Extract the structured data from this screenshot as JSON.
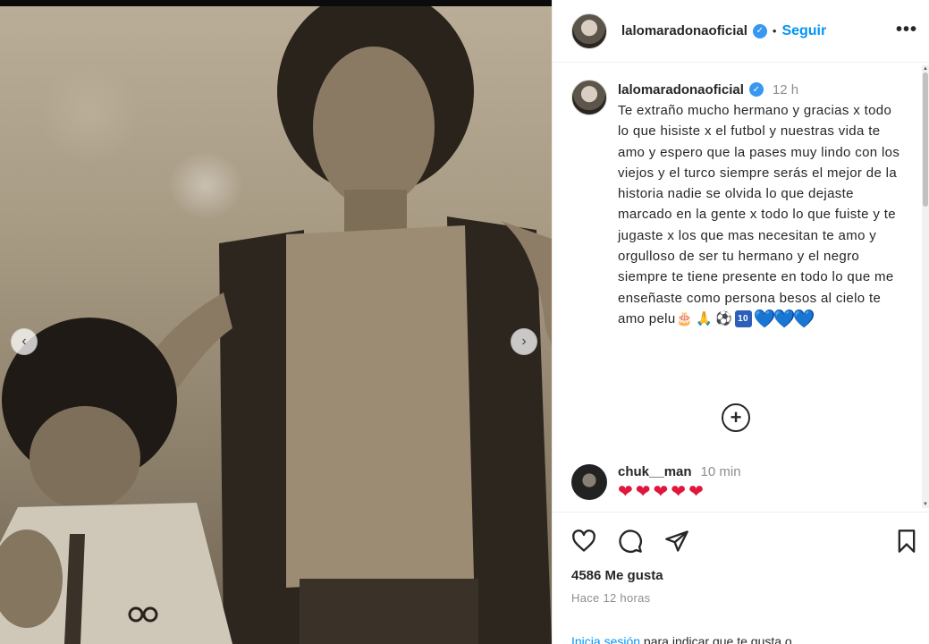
{
  "header": {
    "username": "lalomaradonaoficial",
    "dot": "•",
    "follow_label": "Seguir",
    "more_label": "•••"
  },
  "caption": {
    "username": "lalomaradonaoficial",
    "time_ago": "12 h",
    "text": "Te extraño mucho hermano y gracias x todo lo que hisiste x el futbol y nuestras vida te amo y espero que la pases muy lindo con los viejos y el turco siempre serás el mejor de la historia nadie se olvida lo que dejaste marcado en la gente x todo lo que fuiste y te jugaste x los que mas necesitan te amo y orgulloso de ser tu hermano y el negro siempre te tiene presente en todo lo que me enseñaste como persona besos al cielo te amo pelu",
    "emojis": {
      "cake": "🎂",
      "praying": "🙏",
      "ball": "⚽",
      "ten": "10",
      "heart1": "💙",
      "heart2": "💙",
      "heart3": "💙"
    }
  },
  "load_more_label": "+",
  "comment": {
    "username": "chuk__man",
    "time_ago": "10 min",
    "hearts": [
      "❤",
      "❤",
      "❤",
      "❤",
      "❤"
    ]
  },
  "actions": {
    "likes": "4586 Me gusta",
    "posted": "Hace 12 horas"
  },
  "login_prompt": {
    "link": "Inicia sesión",
    "rest": " para indicar que te gusta o"
  },
  "media": {
    "prev_arrow": "‹",
    "next_arrow": "›"
  },
  "colors": {
    "accent": "#0095f6",
    "verified": "#3897f0",
    "heart_red": "#e0163d",
    "heart_blue": "#1f6fd8"
  }
}
